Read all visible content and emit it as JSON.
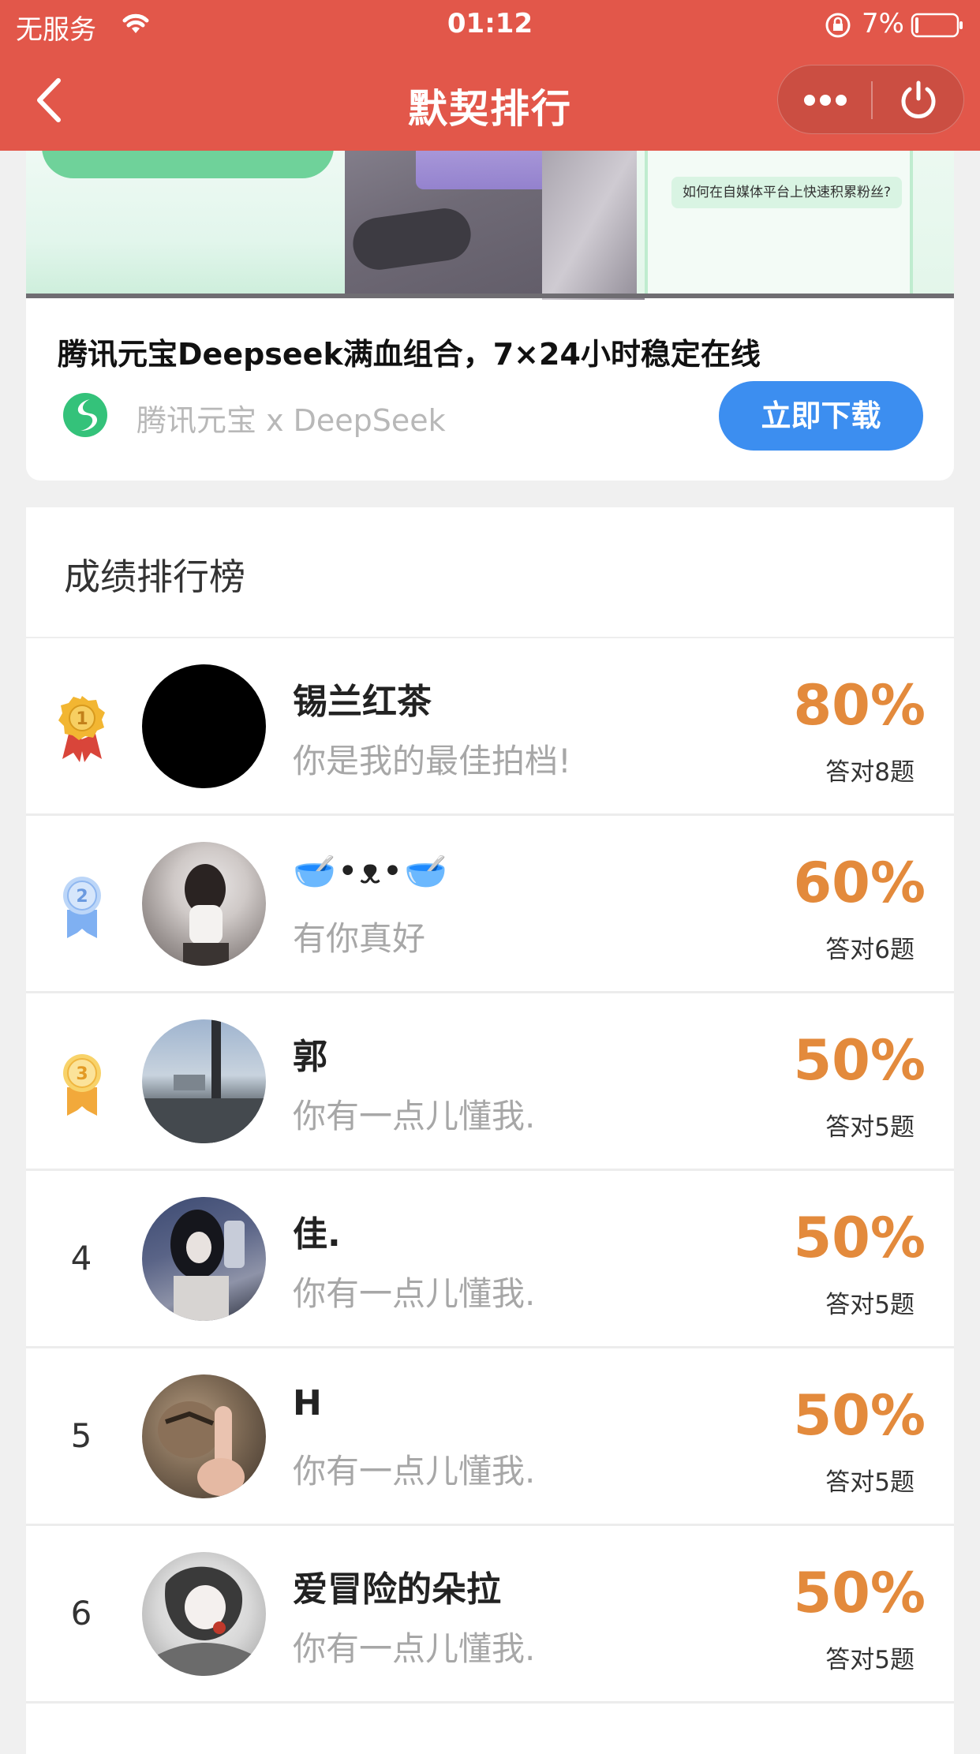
{
  "status_bar": {
    "carrier": "无服务",
    "time": "01:12",
    "battery": "7%"
  },
  "nav": {
    "title": "默契排行"
  },
  "ad": {
    "banner_chip": "如何在自媒体平台上快速积累粉丝?",
    "title": "腾讯元宝Deepseek满血组合，7×24小时稳定在线",
    "brand": "腾讯元宝 x DeepSeek",
    "download_label": "立即下载"
  },
  "leaderboard": {
    "title": "成绩排行榜",
    "entries": [
      {
        "rank": "1",
        "name": "锡兰红茶",
        "comment": "你是我的最佳拍档!",
        "percent": "80%",
        "answered": "答对8题"
      },
      {
        "rank": "2",
        "name": "🥣•ᴥ•🥣",
        "comment": "有你真好",
        "percent": "60%",
        "answered": "答对6题"
      },
      {
        "rank": "3",
        "name": "郭",
        "comment": "你有一点儿懂我.",
        "percent": "50%",
        "answered": "答对5题"
      },
      {
        "rank": "4",
        "name": "佳.",
        "comment": "你有一点儿懂我.",
        "percent": "50%",
        "answered": "答对5题"
      },
      {
        "rank": "5",
        "name": "H",
        "comment": "你有一点儿懂我.",
        "percent": "50%",
        "answered": "答对5题"
      },
      {
        "rank": "6",
        "name": "爱冒险的朵拉",
        "comment": "你有一点儿懂我.",
        "percent": "50%",
        "answered": "答对5题"
      }
    ]
  },
  "colors": {
    "header": "#e2574a",
    "score": "#e38a3c",
    "download_button": "#3c8ef0",
    "gold_medal": "#f2b632",
    "silver_medal": "#8fb7f0",
    "bronze_medal": "#f6c54d"
  }
}
